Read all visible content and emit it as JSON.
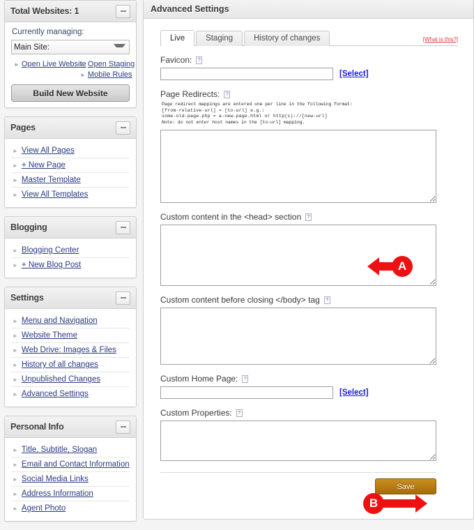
{
  "sidebar": {
    "websites_panel": {
      "title": "Total Websites: 1",
      "collapse_label": "collapse",
      "managing_label": "Currently managing:",
      "site_selected": "Main Site:",
      "site_options": [
        "Main Site:"
      ],
      "links": [
        {
          "label": "Open Live Website"
        },
        {
          "label": "Open Staging"
        },
        {
          "label": "Mobile Rules"
        }
      ],
      "build_button": "Build New Website"
    },
    "pages_panel": {
      "title": "Pages",
      "items": [
        {
          "label": "View All Pages"
        },
        {
          "label": "+ New Page"
        },
        {
          "label": "Master Template"
        },
        {
          "label": "View All Templates"
        }
      ]
    },
    "blogging_panel": {
      "title": "Blogging",
      "items": [
        {
          "label": "Blogging Center"
        },
        {
          "label": "+ New Blog Post"
        }
      ]
    },
    "settings_panel": {
      "title": "Settings",
      "items": [
        {
          "label": "Menu and Navigation"
        },
        {
          "label": "Website Theme"
        },
        {
          "label": "Web Drive: Images & Files"
        },
        {
          "label": "History of all changes"
        },
        {
          "label": "Unpublished Changes"
        },
        {
          "label": "Advanced Settings"
        }
      ]
    },
    "personal_panel": {
      "title": "Personal Info",
      "items": [
        {
          "label": "Title, Subtitle, Slogan"
        },
        {
          "label": "Email and Contact Information"
        },
        {
          "label": "Social Media Links"
        },
        {
          "label": "Address Information"
        },
        {
          "label": "Agent Photo"
        }
      ]
    }
  },
  "main": {
    "title": "Advanced Settings",
    "tabs": [
      {
        "label": "Live",
        "active": true
      },
      {
        "label": "Staging",
        "active": false
      },
      {
        "label": "History of changes",
        "active": false
      }
    ],
    "what_is_this": "[What is this?]",
    "help_icon_glyph": "?",
    "fields": {
      "favicon": {
        "label": "Favicon:",
        "value": "",
        "placeholder": "",
        "select_link": "[Select]"
      },
      "page_redirects": {
        "label": "Page Redirects:",
        "hint_line1": "Page redirect mappings are entered one per line in the following format:",
        "hint_line2": "[from-relative-url] = [to-url] e.g.:",
        "hint_line3": "some-old-page.php = a-new-page.html or http(s)://[new-url]",
        "hint_line4": "Note: do not enter host names in the [to-url] mapping.",
        "value": ""
      },
      "custom_head": {
        "label": "Custom content in the <head> section",
        "value": ""
      },
      "custom_body": {
        "label": "Custom content before closing </body> tag",
        "value": ""
      },
      "custom_home_page": {
        "label": "Custom Home Page:",
        "value": "",
        "select_link": "[Select]"
      },
      "custom_properties": {
        "label": "Custom Properties:",
        "value": ""
      }
    },
    "save_button": "Save"
  },
  "annotations": [
    {
      "id": "A",
      "label": "A",
      "direction": "left",
      "color": "#ee1111"
    },
    {
      "id": "B",
      "label": "B",
      "direction": "right",
      "color": "#ee1111"
    }
  ],
  "colors": {
    "accent_red": "#ee1111",
    "link_blue": "#2a3b80",
    "select_link_blue": "#1a1ae0",
    "save_gold": "#b87c14",
    "what_is_this_red": "#e03a3a"
  }
}
